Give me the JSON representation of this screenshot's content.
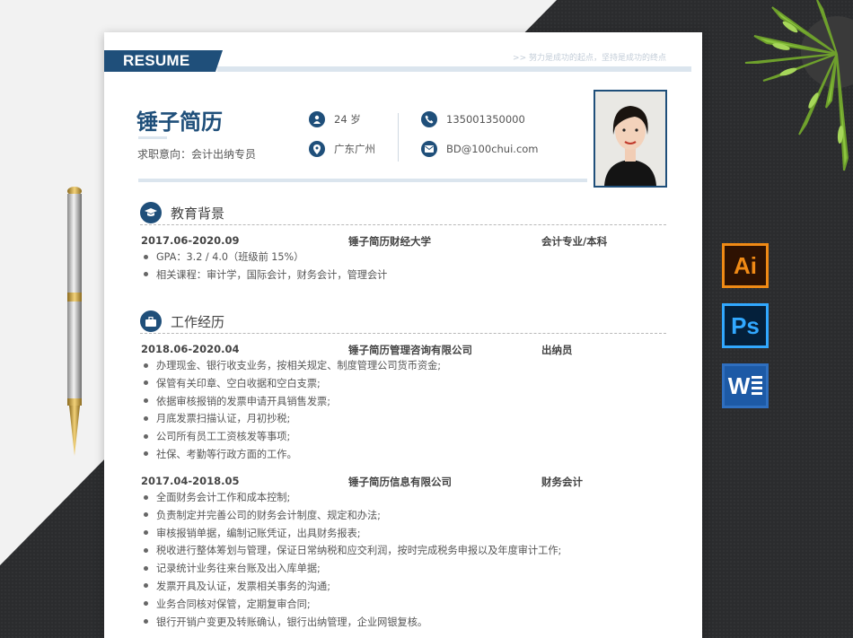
{
  "resume": {
    "header_label": "RESUME",
    "slogan": ">>  努力是成功的起点，坚持是成功的终点",
    "name": "锤子简历",
    "intent": "求职意向：会计出纳专员",
    "info": {
      "age": "24 岁",
      "phone": "135001350000",
      "location": "广东广州",
      "email": "BD@100chui.com"
    }
  },
  "education": {
    "title": "教育背景",
    "period": "2017.06-2020.09",
    "school": "锤子简历财经大学",
    "major": "会计专业/本科",
    "items": [
      "GPA：3.2 / 4.0（班级前 15%）",
      "相关课程：审计学，国际会计，财务会计，管理会计"
    ]
  },
  "work": {
    "title": "工作经历",
    "jobs": [
      {
        "period": "2018.06-2020.04",
        "company": "锤子简历管理咨询有限公司",
        "role": "出纳员",
        "items": [
          "办理现金、银行收支业务，按相关规定、制度管理公司货币资金;",
          "保管有关印章、空白收据和空白支票;",
          "依据审核报销的发票申请开具销售发票;",
          "月底发票扫描认证，月初抄税;",
          "公司所有员工工资核发等事项;",
          "社保、考勤等行政方面的工作。"
        ]
      },
      {
        "period": "2017.04-2018.05",
        "company": "锤子简历信息有限公司",
        "role": "财务会计",
        "items": [
          "全面财务会计工作和成本控制;",
          "负责制定并完善公司的财务会计制度、规定和办法;",
          "审核报销单据，编制记账凭证，出具财务报表;",
          "税收进行整体筹划与管理，保证日常纳税和应交利润，按时完成税务申报以及年度审计工作;",
          "记录统计业务往来台账及出入库单据;",
          "发票开具及认证，发票相关事务的沟通;",
          "业务合同核对保管，定期复审合同;",
          "银行开销户变更及转账确认，银行出纳管理，企业网银复核。"
        ]
      }
    ]
  },
  "apps": {
    "ai": "Ai",
    "ps": "Ps",
    "word": "W"
  },
  "colors": {
    "primary": "#1f4f7a",
    "accent_light": "#dbe5ee",
    "background_dark": "#2b2c2e"
  }
}
